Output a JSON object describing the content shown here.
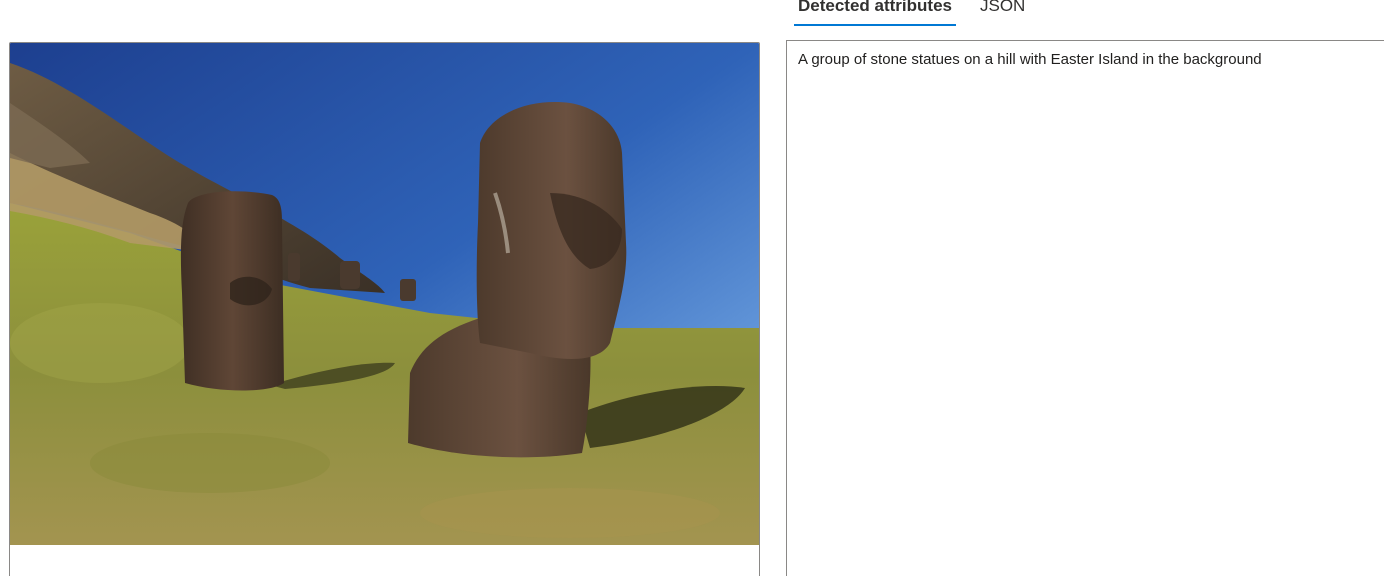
{
  "tabs": [
    {
      "label": "Detected attributes",
      "selected": true
    },
    {
      "label": "JSON",
      "selected": false
    }
  ],
  "result": {
    "caption": "A group of stone statues on a hill with Easter Island in the background"
  },
  "colors": {
    "accent": "#0078d4",
    "border": "#8a8886"
  }
}
